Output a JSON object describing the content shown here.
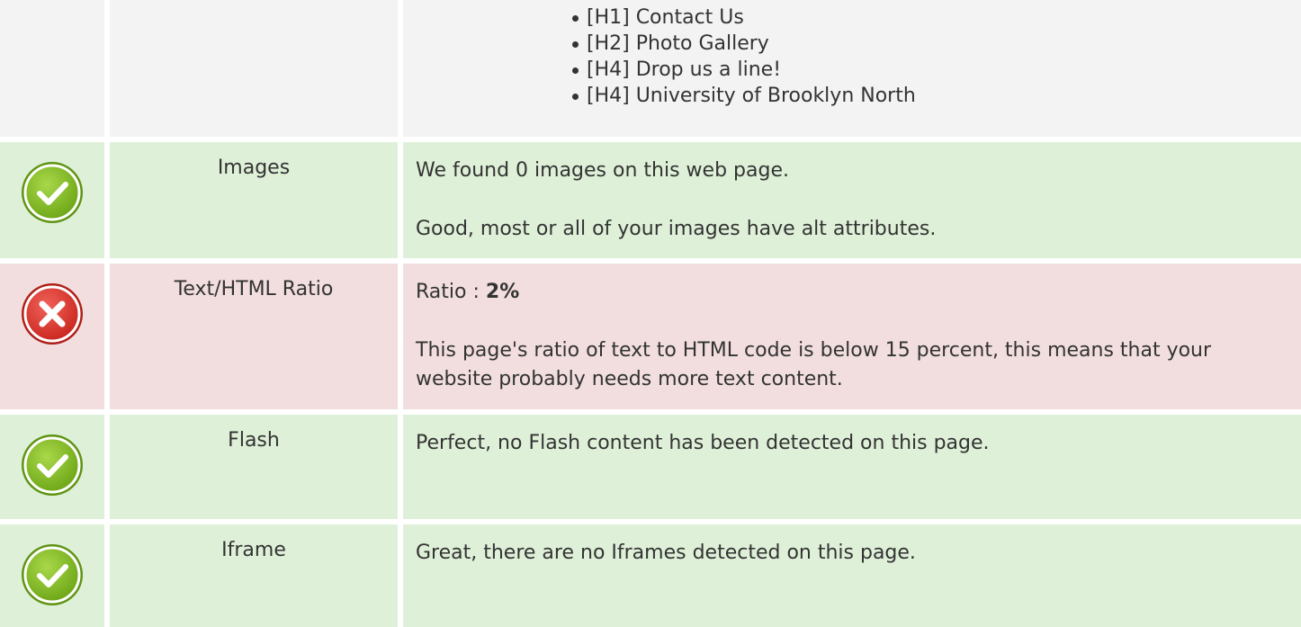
{
  "headings": {
    "items": [
      "[H1] Contact Us",
      "[H2] Photo Gallery",
      "[H4] Drop us a line!",
      "[H4] University of Brooklyn North"
    ]
  },
  "images": {
    "status": "pass",
    "status_icon": "check-circle-icon",
    "name": "Images",
    "found_text": "We found 0 images on this web page.",
    "alt_text": "Good, most or all of your images have alt attributes."
  },
  "ratio": {
    "status": "fail",
    "status_icon": "error-cross-icon",
    "name": "Text/HTML Ratio",
    "label": "Ratio : ",
    "value": "2%",
    "description": "This page's ratio of text to HTML code is below 15 percent, this means that your website probably needs more text content."
  },
  "flash": {
    "status": "pass",
    "status_icon": "check-circle-icon",
    "name": "Flash",
    "description": "Perfect, no Flash content has been detected on this page."
  },
  "iframe": {
    "status": "pass",
    "status_icon": "check-circle-icon",
    "name": "Iframe",
    "description": "Great, there are no Iframes detected on this page."
  },
  "colors": {
    "pass_bg": "#dff0d8",
    "fail_bg": "#f2dede",
    "neutral_bg": "#f3f3f3",
    "pass_icon": "#7dbb1f",
    "fail_icon": "#d9342b"
  }
}
